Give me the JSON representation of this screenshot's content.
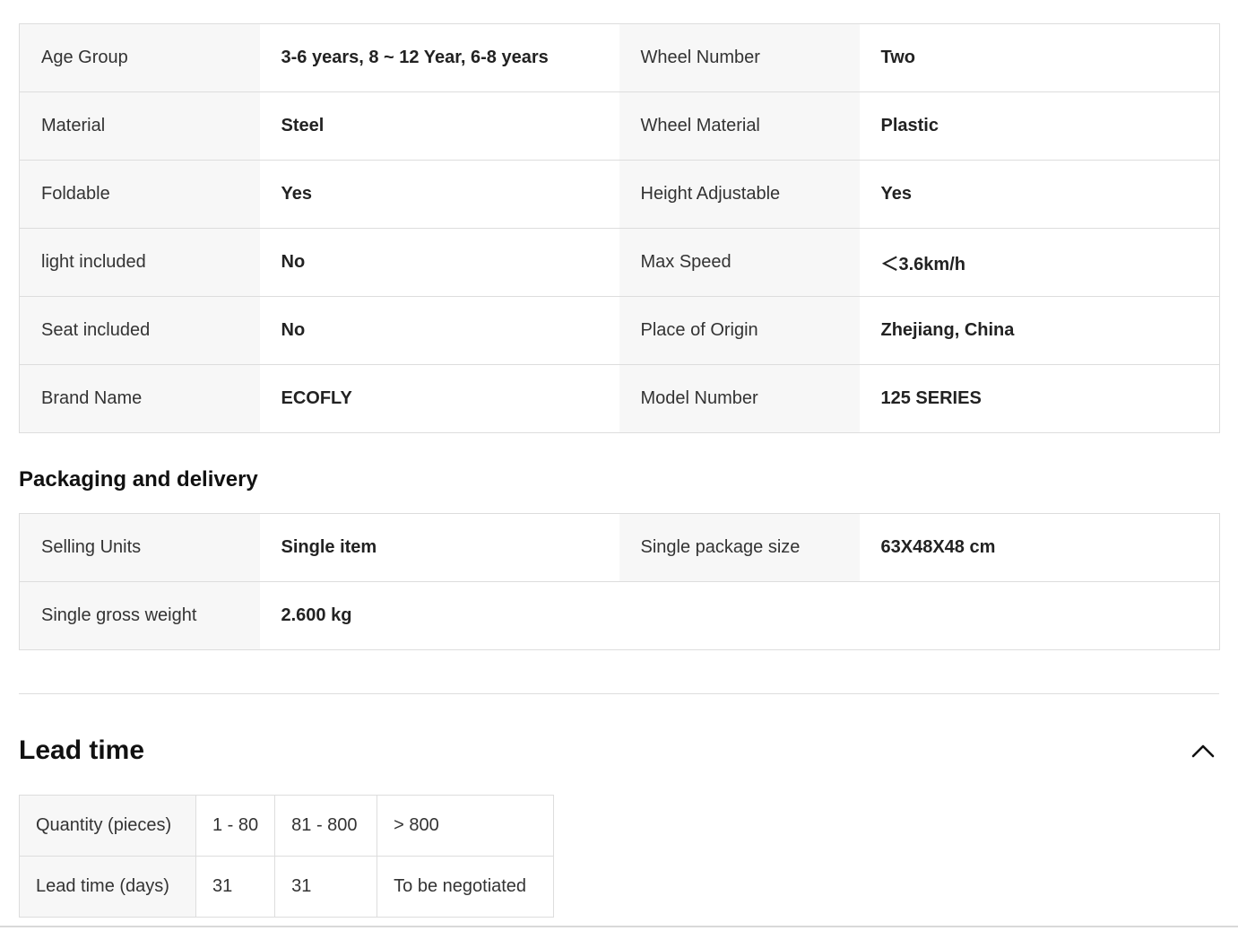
{
  "attributes": [
    [
      {
        "k": "Age Group",
        "v": "3-6 years, 8 ~ 12 Year, 6-8 years"
      },
      {
        "k": "Wheel Number",
        "v": "Two"
      }
    ],
    [
      {
        "k": "Material",
        "v": "Steel"
      },
      {
        "k": "Wheel Material",
        "v": "Plastic"
      }
    ],
    [
      {
        "k": "Foldable",
        "v": "Yes"
      },
      {
        "k": "Height Adjustable",
        "v": "Yes"
      }
    ],
    [
      {
        "k": "light included",
        "v": "No"
      },
      {
        "k": "Max Speed",
        "v": "＜3.6km/h"
      }
    ],
    [
      {
        "k": "Seat included",
        "v": "No"
      },
      {
        "k": "Place of Origin",
        "v": "Zhejiang, China"
      }
    ],
    [
      {
        "k": "Brand Name",
        "v": "ECOFLY"
      },
      {
        "k": "Model Number",
        "v": "125 SERIES"
      }
    ]
  ],
  "packaging": {
    "title": "Packaging and delivery",
    "rows": [
      [
        {
          "k": "Selling Units",
          "v": "Single item"
        },
        {
          "k": "Single package size",
          "v": "63X48X48 cm"
        }
      ],
      [
        {
          "k": "Single gross weight",
          "v": "2.600 kg"
        }
      ]
    ]
  },
  "lead_time": {
    "title": "Lead time",
    "toggle_icon": "chevron-up-icon",
    "header_label": "Quantity (pieces)",
    "ranges": [
      "1 - 80",
      "81 - 800",
      "> 800"
    ],
    "row_label": "Lead time (days)",
    "days": [
      "31",
      "31",
      "To be negotiated"
    ]
  }
}
